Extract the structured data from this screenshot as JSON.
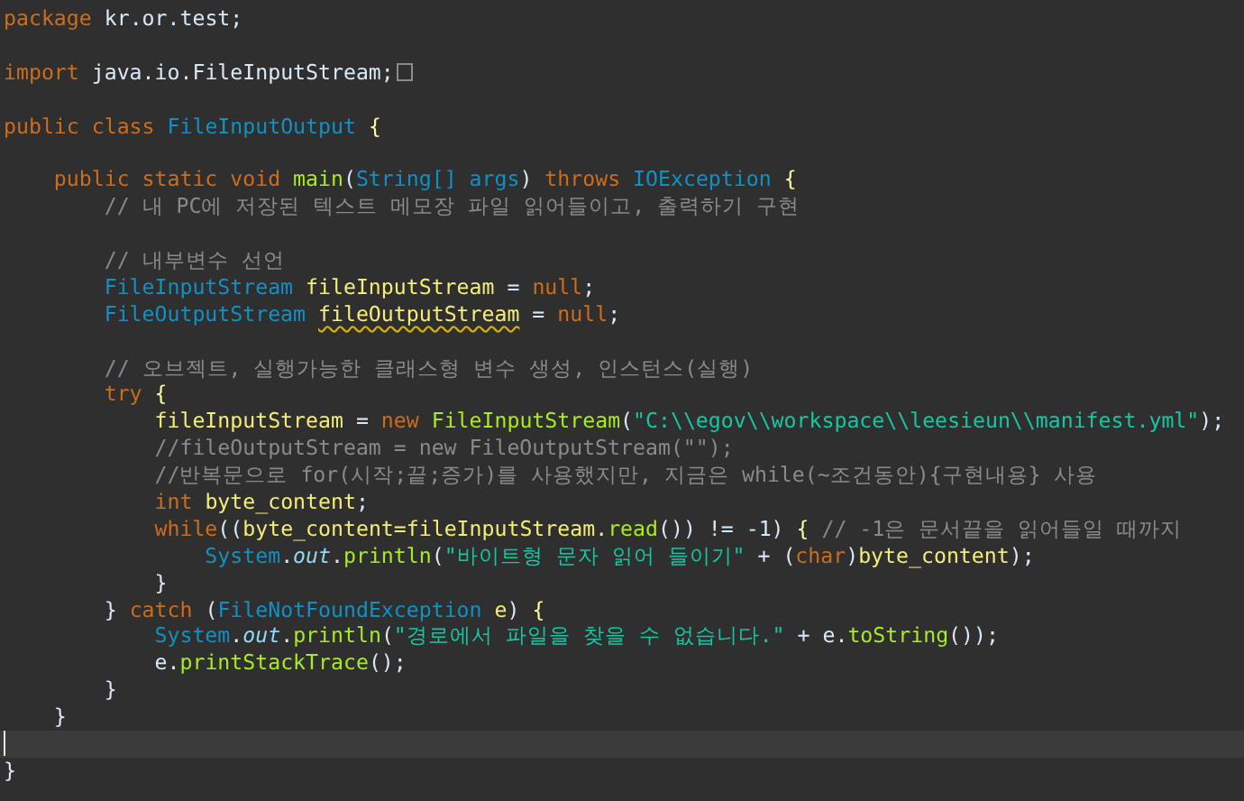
{
  "editor": {
    "lines": [
      {
        "kind": "code",
        "current": false,
        "folded": false,
        "tokens": [
          {
            "kind": "kw",
            "text": "package"
          },
          {
            "kind": "plain",
            "text": " kr.or.test;"
          }
        ]
      },
      {
        "kind": "blank",
        "current": false,
        "folded": false
      },
      {
        "kind": "code",
        "current": false,
        "folded": true,
        "tokens": [
          {
            "kind": "kw",
            "text": "import"
          },
          {
            "kind": "plain",
            "text": " java.io.FileInputStream;"
          }
        ]
      },
      {
        "kind": "blank",
        "current": false,
        "folded": false
      },
      {
        "kind": "code",
        "current": false,
        "folded": false,
        "tokens": [
          {
            "kind": "kw",
            "text": "public class "
          },
          {
            "kind": "type",
            "text": "FileInputOutput "
          },
          {
            "kind": "brace",
            "text": "{"
          }
        ]
      },
      {
        "kind": "blank",
        "current": false,
        "folded": false
      },
      {
        "kind": "code",
        "current": false,
        "folded": false,
        "tokens": [
          {
            "kind": "kw",
            "text": "    public static void "
          },
          {
            "kind": "method",
            "text": "main"
          },
          {
            "kind": "plain",
            "text": "("
          },
          {
            "kind": "type",
            "text": "String[] args"
          },
          {
            "kind": "plain",
            "text": ") "
          },
          {
            "kind": "kw",
            "text": "throws "
          },
          {
            "kind": "type",
            "text": "IOException "
          },
          {
            "kind": "brace",
            "text": "{"
          }
        ]
      },
      {
        "kind": "code",
        "current": false,
        "folded": false,
        "tokens": [
          {
            "kind": "comment",
            "text": "        // 내 PC에 저장된 텍스트 메모장 파일 읽어들이고, 출력하기 구현"
          }
        ]
      },
      {
        "kind": "blank",
        "current": false,
        "folded": false
      },
      {
        "kind": "code",
        "current": false,
        "folded": false,
        "tokens": [
          {
            "kind": "comment",
            "text": "        // 내부변수 선언"
          }
        ]
      },
      {
        "kind": "code",
        "current": false,
        "folded": false,
        "tokens": [
          {
            "kind": "type",
            "text": "        FileInputStream "
          },
          {
            "kind": "var",
            "text": "fileInputStream"
          },
          {
            "kind": "plain",
            "text": " = "
          },
          {
            "kind": "kw",
            "text": "null"
          },
          {
            "kind": "plain",
            "text": ";"
          }
        ]
      },
      {
        "kind": "code",
        "current": false,
        "folded": false,
        "tokens": [
          {
            "kind": "type",
            "text": "        FileOutputStream "
          },
          {
            "kind": "var",
            "text": "fileOutputStream",
            "warning": true
          },
          {
            "kind": "plain",
            "text": " = "
          },
          {
            "kind": "kw",
            "text": "null"
          },
          {
            "kind": "plain",
            "text": ";"
          }
        ]
      },
      {
        "kind": "blank",
        "current": false,
        "folded": false
      },
      {
        "kind": "code",
        "current": false,
        "folded": false,
        "tokens": [
          {
            "kind": "comment",
            "text": "        // 오브젝트, 실행가능한 클래스형 변수 생성, 인스턴스(실행)"
          }
        ]
      },
      {
        "kind": "code",
        "current": false,
        "folded": false,
        "tokens": [
          {
            "kind": "kw",
            "text": "        try "
          },
          {
            "kind": "brace",
            "text": "{"
          }
        ]
      },
      {
        "kind": "code",
        "current": false,
        "folded": false,
        "tokens": [
          {
            "kind": "var",
            "text": "            fileInputStream"
          },
          {
            "kind": "plain",
            "text": " = "
          },
          {
            "kind": "kw",
            "text": "new "
          },
          {
            "kind": "method",
            "text": "FileInputStream"
          },
          {
            "kind": "plain",
            "text": "("
          },
          {
            "kind": "str",
            "text": "\"C:\\\\egov\\\\workspace\\\\leesieun\\\\manifest.yml\""
          },
          {
            "kind": "plain",
            "text": ");"
          }
        ]
      },
      {
        "kind": "code",
        "current": false,
        "folded": false,
        "tokens": [
          {
            "kind": "comment",
            "text": "            //fileOutputStream = new FileOutputStream(\"\");"
          }
        ]
      },
      {
        "kind": "code",
        "current": false,
        "folded": false,
        "tokens": [
          {
            "kind": "comment",
            "text": "            //반복문으로 for(시작;끝;증가)를 사용했지만, 지금은 while(~조건동안){구현내용} 사용"
          }
        ]
      },
      {
        "kind": "code",
        "current": false,
        "folded": false,
        "tokens": [
          {
            "kind": "kw",
            "text": "            int "
          },
          {
            "kind": "var",
            "text": "byte_content"
          },
          {
            "kind": "plain",
            "text": ";"
          }
        ]
      },
      {
        "kind": "code",
        "current": false,
        "folded": false,
        "tokens": [
          {
            "kind": "kw",
            "text": "            while"
          },
          {
            "kind": "plain",
            "text": "(("
          },
          {
            "kind": "var",
            "text": "byte_content=fileInputStream."
          },
          {
            "kind": "method",
            "text": "read"
          },
          {
            "kind": "plain",
            "text": "()) != -1) "
          },
          {
            "kind": "brace",
            "text": "{"
          },
          {
            "kind": "comment",
            "text": " // -1은 문서끝을 읽어들일 때까지"
          }
        ]
      },
      {
        "kind": "code",
        "current": false,
        "folded": false,
        "tokens": [
          {
            "kind": "type",
            "text": "                System"
          },
          {
            "kind": "plain",
            "text": "."
          },
          {
            "kind": "field",
            "text": "out"
          },
          {
            "kind": "plain",
            "text": "."
          },
          {
            "kind": "method",
            "text": "println"
          },
          {
            "kind": "plain",
            "text": "("
          },
          {
            "kind": "str",
            "text": "\"바이트형 문자 읽어 들이기\""
          },
          {
            "kind": "plain",
            "text": " + ("
          },
          {
            "kind": "kw",
            "text": "char"
          },
          {
            "kind": "plain",
            "text": ")"
          },
          {
            "kind": "var",
            "text": "byte_content"
          },
          {
            "kind": "plain",
            "text": ");"
          }
        ]
      },
      {
        "kind": "code",
        "current": false,
        "folded": false,
        "tokens": [
          {
            "kind": "plain",
            "text": "            }"
          }
        ]
      },
      {
        "kind": "code",
        "current": false,
        "folded": false,
        "tokens": [
          {
            "kind": "plain",
            "text": "        } "
          },
          {
            "kind": "kw",
            "text": "catch"
          },
          {
            "kind": "plain",
            "text": " ("
          },
          {
            "kind": "type",
            "text": "FileNotFoundException"
          },
          {
            "kind": "var",
            "text": " e"
          },
          {
            "kind": "plain",
            "text": ") "
          },
          {
            "kind": "brace",
            "text": "{"
          }
        ]
      },
      {
        "kind": "code",
        "current": false,
        "folded": false,
        "tokens": [
          {
            "kind": "type",
            "text": "            System"
          },
          {
            "kind": "plain",
            "text": "."
          },
          {
            "kind": "field",
            "text": "out"
          },
          {
            "kind": "plain",
            "text": "."
          },
          {
            "kind": "method",
            "text": "println"
          },
          {
            "kind": "plain",
            "text": "("
          },
          {
            "kind": "str",
            "text": "\"경로에서 파일을 찾을 수 없습니다.\""
          },
          {
            "kind": "plain",
            "text": " + e."
          },
          {
            "kind": "method",
            "text": "toString"
          },
          {
            "kind": "plain",
            "text": "());"
          }
        ]
      },
      {
        "kind": "code",
        "current": false,
        "folded": false,
        "tokens": [
          {
            "kind": "plain",
            "text": "            e."
          },
          {
            "kind": "method",
            "text": "printStackTrace"
          },
          {
            "kind": "plain",
            "text": "();"
          }
        ]
      },
      {
        "kind": "code",
        "current": false,
        "folded": false,
        "tokens": [
          {
            "kind": "plain",
            "text": "        }"
          }
        ]
      },
      {
        "kind": "code",
        "current": false,
        "folded": false,
        "tokens": [
          {
            "kind": "plain",
            "text": "    }"
          }
        ]
      },
      {
        "kind": "blank",
        "current": true,
        "folded": false
      },
      {
        "kind": "code",
        "current": false,
        "folded": false,
        "tokens": [
          {
            "kind": "plain",
            "text": "}"
          }
        ]
      }
    ]
  }
}
